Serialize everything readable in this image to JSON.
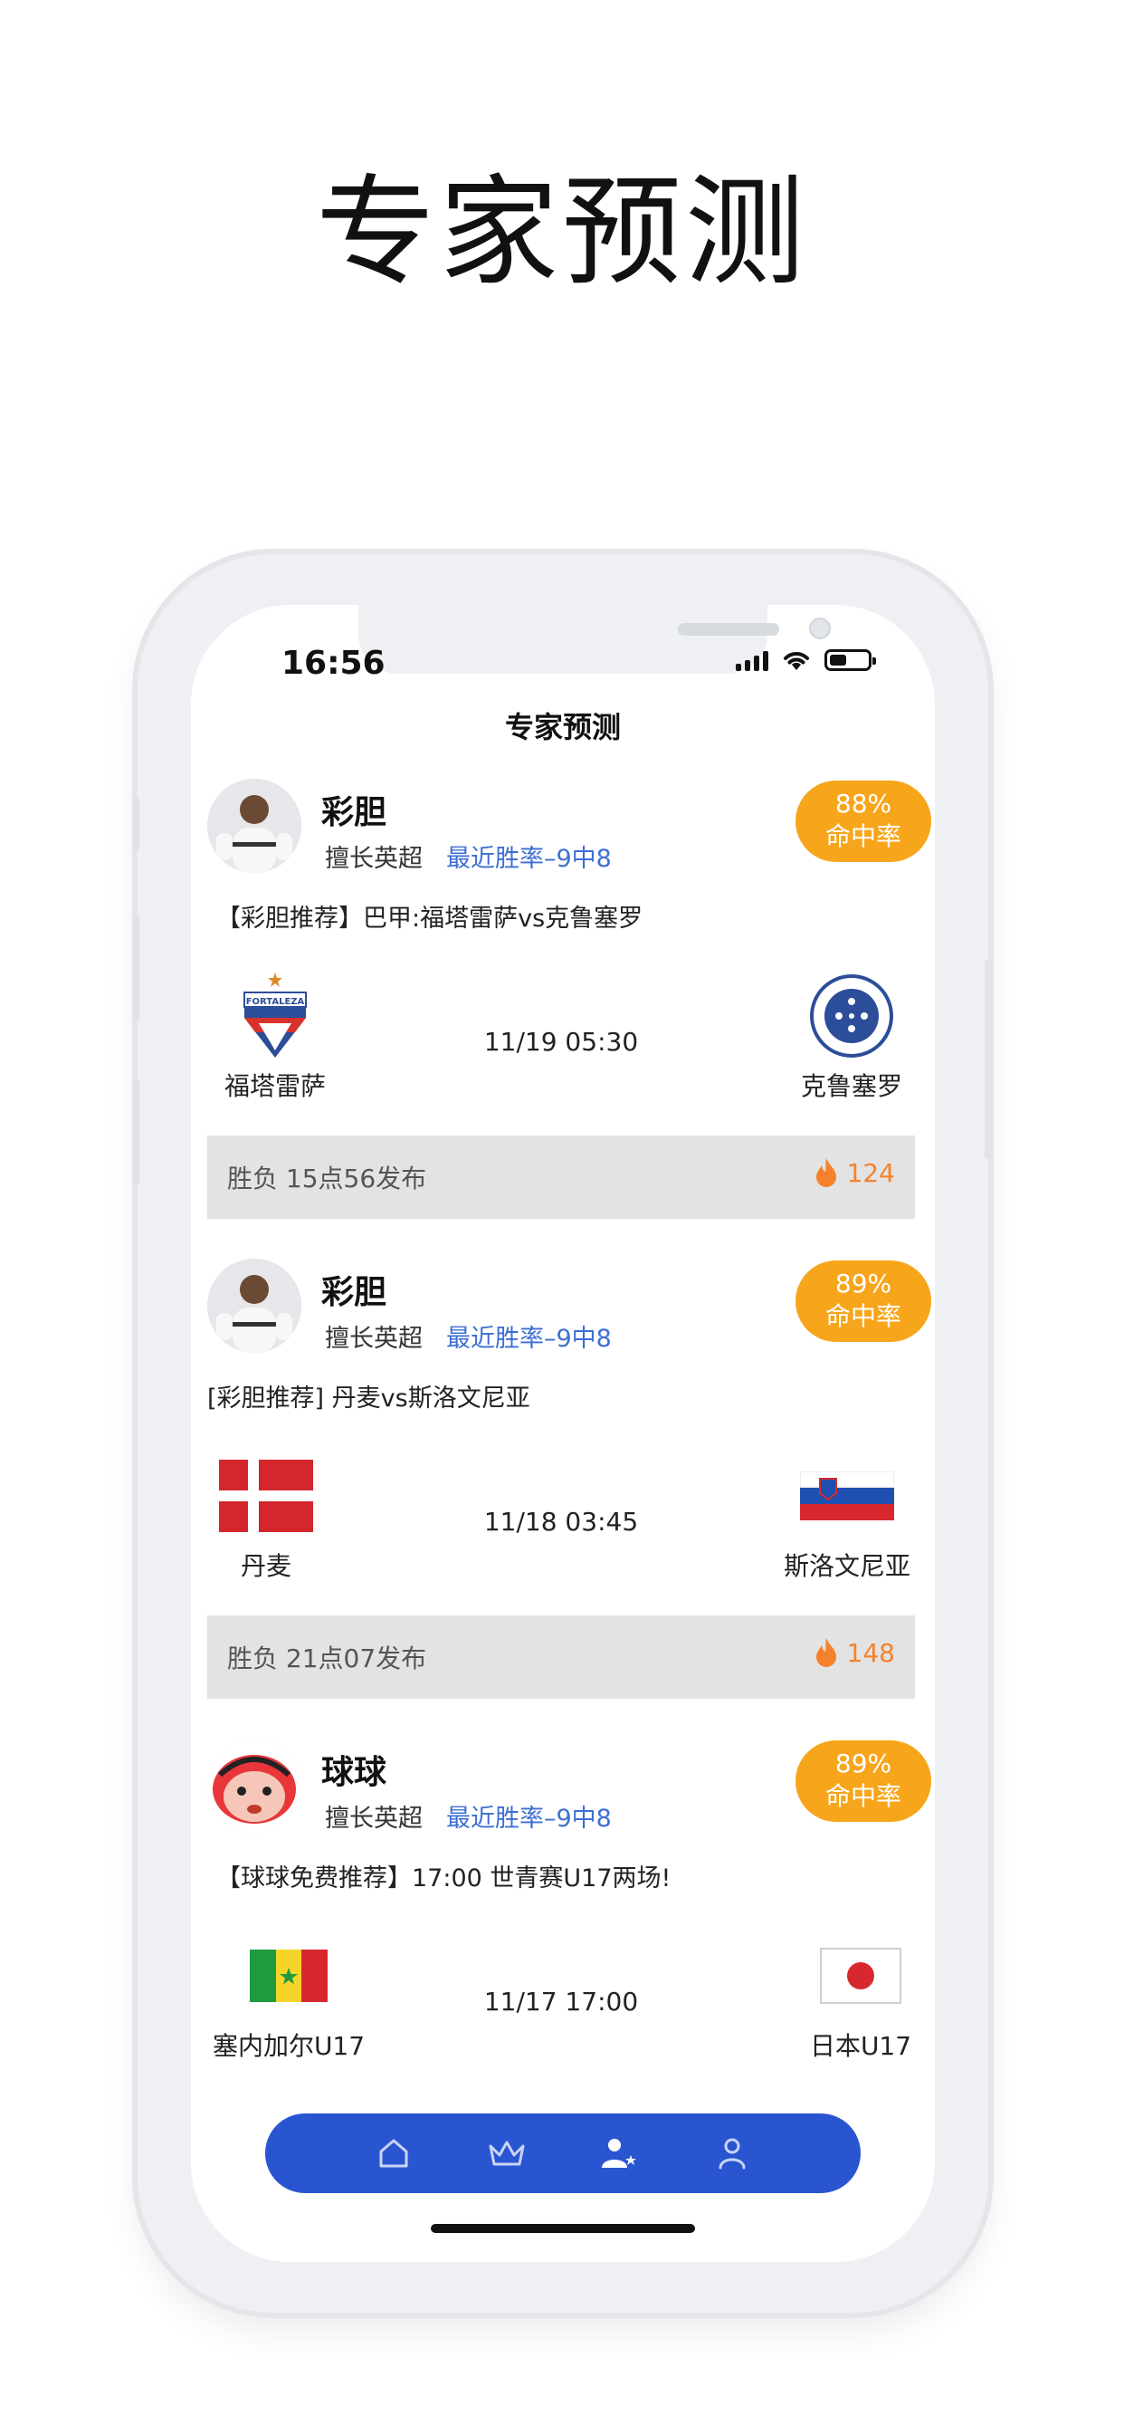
{
  "hero": {
    "title": "专家预测"
  },
  "status_bar": {
    "time": "16:56"
  },
  "header": {
    "title": "专家预测"
  },
  "colors": {
    "accent": "#2a55d1",
    "badge": "#f7a51b",
    "rate_text": "#3d6fd1",
    "heat": "#f5822b"
  },
  "cards": [
    {
      "expert": {
        "name": "彩胆",
        "specialty": "擅长英超",
        "recent_rate": "最近胜率–9中8",
        "hit_percent": "88%",
        "hit_label": "命中率",
        "avatar_icon": "player-avatar"
      },
      "match": {
        "title": "【彩胆推荐】巴甲:福塔雷萨vs克鲁塞罗",
        "home": "福塔雷萨",
        "away": "克鲁塞罗",
        "time": "11/19 05:30",
        "home_logo": "fortaleza-crest-icon",
        "away_logo": "cruzeiro-crest-icon"
      },
      "pick": {
        "info": "胜负   15点56发布",
        "heat": "124"
      }
    },
    {
      "expert": {
        "name": "彩胆",
        "specialty": "擅长英超",
        "recent_rate": "最近胜率–9中8",
        "hit_percent": "89%",
        "hit_label": "命中率",
        "avatar_icon": "player-avatar"
      },
      "match": {
        "title": "[彩胆推荐] 丹麦vs斯洛文尼亚",
        "home": "丹麦",
        "away": "斯洛文尼亚",
        "time": "11/18 03:45",
        "home_logo": "denmark-flag-icon",
        "away_logo": "slovenia-flag-icon"
      },
      "pick": {
        "info": "胜负   21点07发布",
        "heat": "148"
      }
    },
    {
      "expert": {
        "name": "球球",
        "specialty": "擅长英超",
        "recent_rate": "最近胜率–9中8",
        "hit_percent": "89%",
        "hit_label": "命中率",
        "avatar_icon": "cartoon-avatar"
      },
      "match": {
        "title": "【球球免费推荐】17:00 世青赛U17两场!",
        "home": "塞内加尔U17",
        "away": "日本U17",
        "time": "11/17 17:00",
        "home_logo": "senegal-flag-icon",
        "away_logo": "japan-flag-icon"
      }
    }
  ],
  "tabbar": {
    "items": [
      "home-icon",
      "crown-icon",
      "experts-icon",
      "profile-icon"
    ]
  }
}
